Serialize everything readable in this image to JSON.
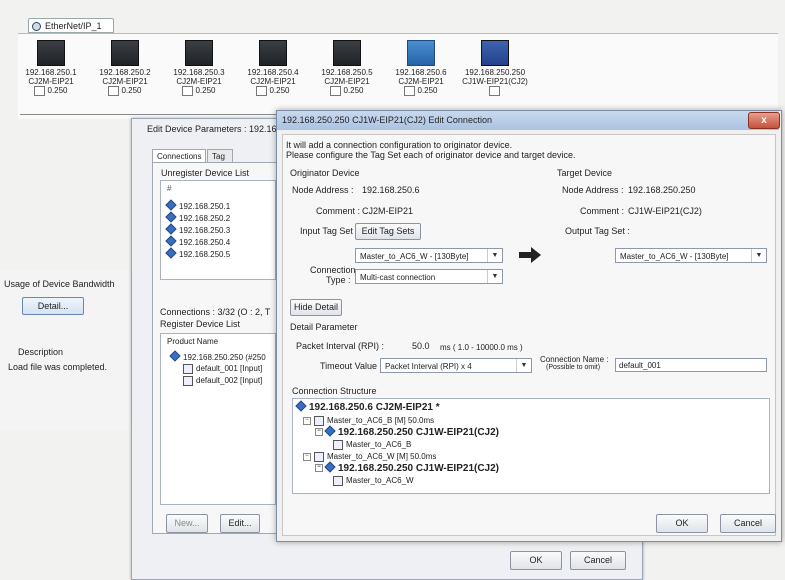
{
  "network_tab": {
    "label": "EtherNet/IP_1"
  },
  "devices": [
    {
      "address": "192.168.250.1",
      "model": "CJ2M-EIP21",
      "node": "0.250",
      "kind": "dark"
    },
    {
      "address": "192.168.250.2",
      "model": "CJ2M-EIP21",
      "node": "0.250",
      "kind": "dark"
    },
    {
      "address": "192.168.250.3",
      "model": "CJ2M-EIP21",
      "node": "0.250",
      "kind": "dark"
    },
    {
      "address": "192.168.250.4",
      "model": "CJ2M-EIP21",
      "node": "0.250",
      "kind": "dark"
    },
    {
      "address": "192.168.250.5",
      "model": "CJ2M-EIP21",
      "node": "0.250",
      "kind": "dark"
    },
    {
      "address": "192.168.250.6",
      "model": "CJ2M-EIP21",
      "node": "0.250",
      "kind": "blue"
    },
    {
      "address": "192.168.250.250",
      "model": "CJ1W-EIP21(CJ2)",
      "node": "",
      "kind": "cj2"
    }
  ],
  "left_panel": {
    "bandwidth_title": "Usage of Device Bandwidth",
    "detail_button": "Detail...",
    "description_title": "Description",
    "description_value": "Load file was completed."
  },
  "edit_params": {
    "title": "Edit Device Parameters : 192.16",
    "tabs": [
      "Connections",
      "Tag Sets"
    ],
    "unregister_label": "Unregister Device List",
    "unregister_col": "#",
    "unregister_items": [
      "192.168.250.1",
      "192.168.250.2",
      "192.168.250.3",
      "192.168.250.4",
      "192.168.250.5"
    ],
    "connections_label": "Connections :  3/32 (O : 2, T",
    "register_label": "Register Device List",
    "product_col": "Product Name",
    "register_items": [
      "192.168.250.250 (#250",
      "default_001 [Input]",
      "default_002 [Input]"
    ],
    "new_button": "New...",
    "edit_button": "Edit...",
    "ok_button": "OK",
    "cancel_button": "Cancel"
  },
  "dialog": {
    "title": "192.168.250.250 CJ1W-EIP21(CJ2) Edit Connection",
    "close": "x",
    "info_line1": "It will add a connection configuration to originator device.",
    "info_line2": "Please configure the Tag Set each of originator device and target device.",
    "originator_title": "Originator Device",
    "orig_node_label": "Node Address :",
    "orig_node_value": "192.168.250.6",
    "orig_comment_label": "Comment :",
    "orig_comment_value": "CJ2M-EIP21",
    "input_tagset_label": "Input Tag Set :",
    "edit_tagsets_button": "Edit Tag Sets",
    "input_tagset_value": "Master_to_AC6_W - [130Byte]",
    "conn_type_label1": "Connection",
    "conn_type_label2": "Type :",
    "conn_type_value": "Multi-cast connection",
    "target_title": "Target Device",
    "tgt_node_label": "Node Address :",
    "tgt_node_value": "192.168.250.250",
    "tgt_comment_label": "Comment :",
    "tgt_comment_value": "CJ1W-EIP21(CJ2)",
    "output_tagset_label": "Output Tag Set :",
    "output_tagset_value": "Master_to_AC6_W - [130Byte]",
    "hide_detail_button": "Hide Detail",
    "detail_param_title": "Detail Parameter",
    "rpi_label": "Packet Interval (RPI) :",
    "rpi_value": "50.0",
    "rpi_unit": "ms ( 1.0 - 10000.0 ms )",
    "timeout_label": "Timeout Value :",
    "timeout_value": "Packet Interval (RPI) x 4",
    "conn_name_label1": "Connection Name :",
    "conn_name_label2": "(Possible to omit)",
    "conn_name_value": "default_001",
    "structure_title": "Connection Structure",
    "tree": [
      {
        "text": "192.168.250.6 CJ2M-EIP21 *",
        "level": 0,
        "big": true
      },
      {
        "text": "Master_to_AC6_B [M] 50.0ms",
        "level": 1,
        "big": false
      },
      {
        "text": "192.168.250.250 CJ1W-EIP21(CJ2)",
        "level": 2,
        "big": true
      },
      {
        "text": "Master_to_AC6_B",
        "level": 3,
        "big": false
      },
      {
        "text": "Master_to_AC6_W [M] 50.0ms",
        "level": 1,
        "big": false
      },
      {
        "text": "192.168.250.250 CJ1W-EIP21(CJ2)",
        "level": 2,
        "big": true
      },
      {
        "text": "Master_to_AC6_W",
        "level": 3,
        "big": false
      }
    ],
    "ok_button": "OK",
    "cancel_button": "Cancel"
  }
}
